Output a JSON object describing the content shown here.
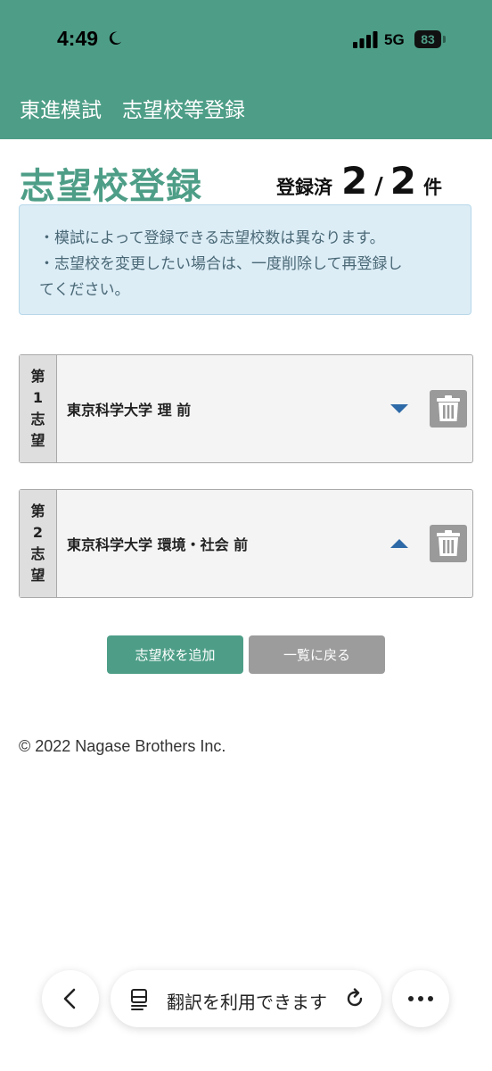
{
  "status_bar": {
    "time": "4:49",
    "network": "5G",
    "battery": "83"
  },
  "header": {
    "title": "東進模試　志望校等登録"
  },
  "page": {
    "title": "志望校登録",
    "count_label": "登録済",
    "count_registered": "2",
    "count_separator": "/",
    "count_max": "2",
    "count_unit": "件"
  },
  "notice": {
    "line1": "・模試によって登録できる志望校数は異なります。",
    "line2": "・志望校を変更したい場合は、一度削除して再登録し",
    "line3": "てください。"
  },
  "choices": [
    {
      "rank": [
        "第",
        "1",
        "志",
        "望"
      ],
      "school": "東京科学大学 理 前",
      "arrow": "down"
    },
    {
      "rank": [
        "第",
        "2",
        "志",
        "望"
      ],
      "school": "東京科学大学 環境・社会 前",
      "arrow": "up"
    }
  ],
  "buttons": {
    "add": "志望校を追加",
    "back": "一覧に戻る"
  },
  "footer": {
    "copyright": "© 2022 Nagase Brothers Inc."
  },
  "browser_bar": {
    "translate_text": "翻訳を利用できます"
  },
  "colors": {
    "brand": "#4e9e87",
    "notice_bg": "#dcedf6",
    "arrow": "#2e6aa8"
  }
}
